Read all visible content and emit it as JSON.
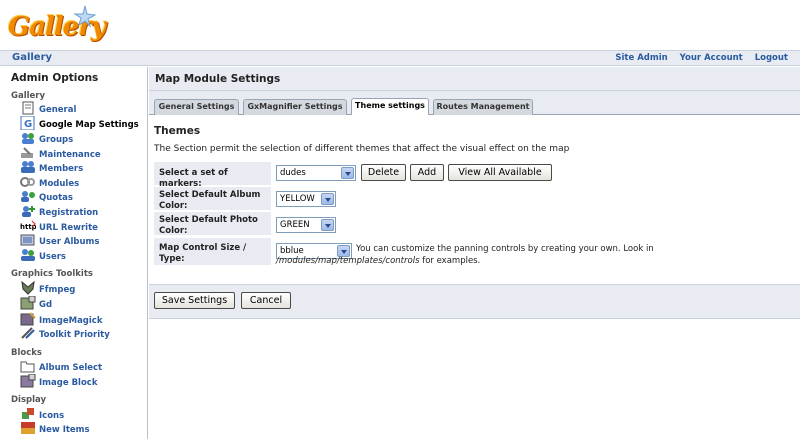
{
  "app": {
    "logo_text": "Gallery",
    "breadcrumb": "Gallery",
    "user_links": [
      "Site Admin",
      "Your Account",
      "Logout"
    ]
  },
  "sidebar": {
    "title": "Admin Options",
    "groups": [
      {
        "title": "Gallery",
        "items": [
          {
            "label": "General",
            "icon": "general-icon"
          },
          {
            "label": "Google Map Settings",
            "icon": "google-map-icon",
            "active": true
          },
          {
            "label": "Groups",
            "icon": "groups-icon"
          },
          {
            "label": "Maintenance",
            "icon": "maintenance-icon"
          },
          {
            "label": "Members",
            "icon": "members-icon"
          },
          {
            "label": "Modules",
            "icon": "modules-icon"
          },
          {
            "label": "Quotas",
            "icon": "quotas-icon"
          },
          {
            "label": "Registration",
            "icon": "registration-icon"
          },
          {
            "label": "URL Rewrite",
            "icon": "url-rewrite-icon"
          },
          {
            "label": "User Albums",
            "icon": "user-albums-icon"
          },
          {
            "label": "Users",
            "icon": "users-icon"
          }
        ]
      },
      {
        "title": "Graphics Toolkits",
        "items": [
          {
            "label": "Ffmpeg",
            "icon": "ffmpeg-icon"
          },
          {
            "label": "Gd",
            "icon": "gd-icon"
          },
          {
            "label": "ImageMagick",
            "icon": "imagemagick-icon"
          },
          {
            "label": "Toolkit Priority",
            "icon": "toolkit-priority-icon"
          }
        ]
      },
      {
        "title": "Blocks",
        "items": [
          {
            "label": "Album Select",
            "icon": "album-select-icon"
          },
          {
            "label": "Image Block",
            "icon": "image-block-icon"
          }
        ]
      },
      {
        "title": "Display",
        "items": [
          {
            "label": "Icons",
            "icon": "icons-icon"
          },
          {
            "label": "New Items",
            "icon": "new-items-icon"
          }
        ]
      }
    ]
  },
  "main": {
    "title": "Map Module Settings",
    "tabs": [
      {
        "label": "General Settings",
        "active": false
      },
      {
        "label": "GxMagnifier Settings",
        "active": false
      },
      {
        "label": "Theme settings",
        "active": true
      },
      {
        "label": "Routes Management",
        "active": false
      }
    ],
    "section_title": "Themes",
    "section_desc": "The Section permit the selection of different themes that affect the visual effect on the map",
    "rows": {
      "markers": {
        "label": "Select a set of markers:",
        "value": "dudes",
        "buttons": [
          "Delete",
          "Add",
          "View All Available"
        ]
      },
      "album_color": {
        "label": "Select Default Album Color:",
        "value": "YELLOW"
      },
      "photo_color": {
        "label": "Select Default Photo Color:",
        "value": "GREEN"
      },
      "control_size": {
        "label": "Map Control Size / Type:",
        "value": "bblue",
        "hint_text": "You can customize the panning controls by creating your own. Look in",
        "hint_path": "/modules/map/templates/controls",
        "hint_tail": "for examples."
      }
    },
    "save_label": "Save Settings",
    "cancel_label": "Cancel"
  }
}
